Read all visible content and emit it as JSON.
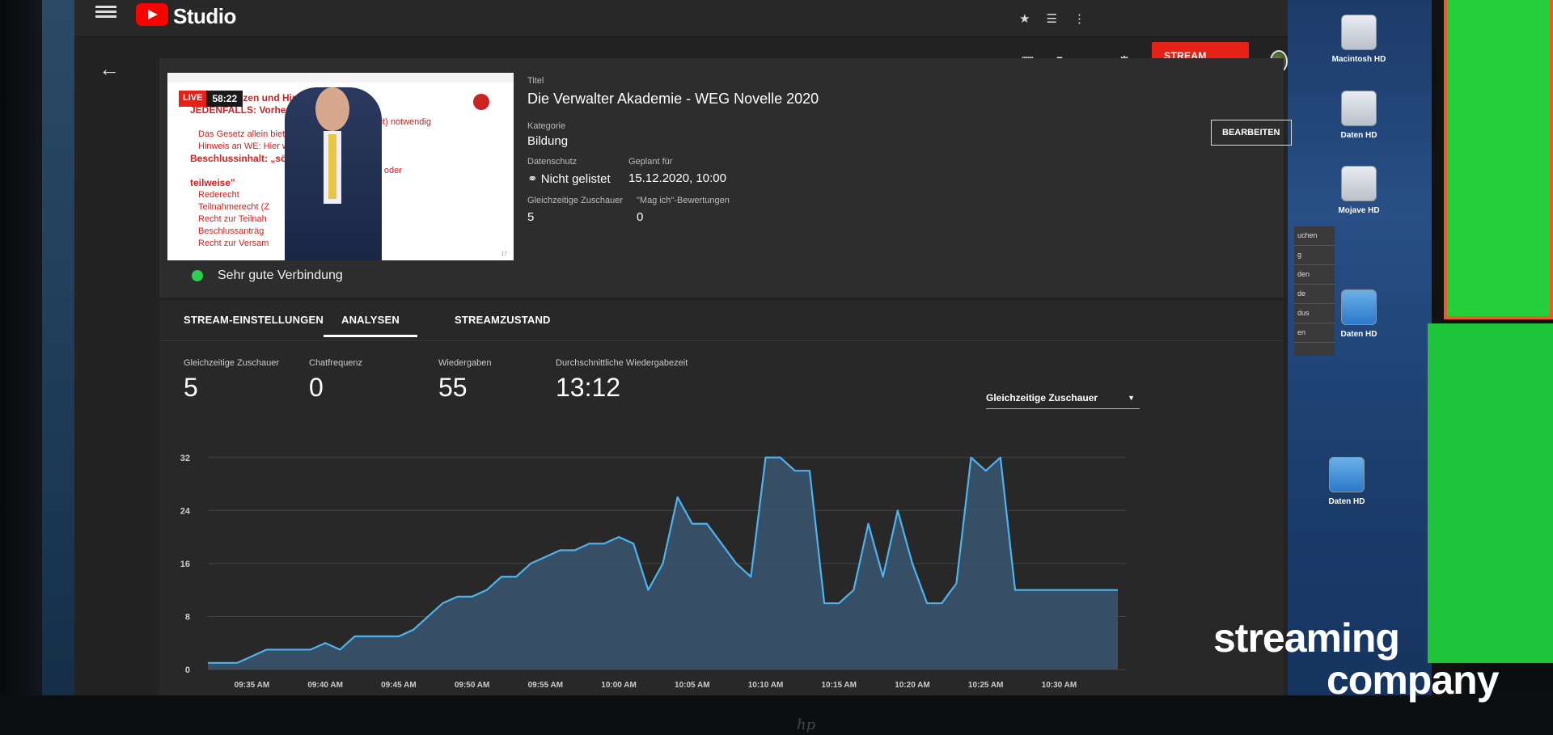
{
  "app": {
    "name": "Studio"
  },
  "actions": {
    "stream_end": "STREAM BEENDEN",
    "edit": "BEARBEITEN"
  },
  "preview": {
    "live_label": "LIVE",
    "elapsed": "58:22",
    "slide_lines": [
      "Konsequenzen und Hinw",
      "JEDENFALLS: Vorheriger B",
      "(einfache Mehrheit) notwendig",
      "Das Gesetz allein bietet kei",
      "Hinweis an WE: Hier wird",
      "Beschlussinhalt: „sö",
      "ihrer Rechte ganz oder",
      "teilweise\"",
      "Rederecht",
      "Teilnahmerecht (Z",
      "Recht zur Teilnah",
      "Beschlussanträg",
      "Recht zur Versam"
    ],
    "slide_page": "17"
  },
  "connection": {
    "status": "Sehr gute Verbindung"
  },
  "meta": {
    "title_label": "Titel",
    "title": "Die Verwalter Akademie - WEG Novelle 2020",
    "category_label": "Kategorie",
    "category": "Bildung",
    "privacy_label": "Datenschutz",
    "privacy": "Nicht gelistet",
    "scheduled_label": "Geplant für",
    "scheduled": "15.12.2020, 10:00",
    "concurrent_label": "Gleichzeitige Zuschauer",
    "concurrent": "5",
    "likes_label": "\"Mag ich\"-Bewertungen",
    "likes": "0"
  },
  "tabs": [
    {
      "label": "STREAM-EINSTELLUNGEN"
    },
    {
      "label": "ANALYSEN"
    },
    {
      "label": "STREAMZUSTAND"
    }
  ],
  "stats": [
    {
      "label": "Gleichzeitige Zuschauer",
      "value": "5"
    },
    {
      "label": "Chatfrequenz",
      "value": "0"
    },
    {
      "label": "Wiedergaben",
      "value": "55"
    },
    {
      "label": "Durchschnittliche Wiedergabezeit",
      "value": "13:12"
    }
  ],
  "metric_select": {
    "value": "Gleichzeitige Zuschauer"
  },
  "desktop_icons": [
    {
      "label": "Macintosh HD"
    },
    {
      "label": "Daten HD"
    },
    {
      "label": "Mojave HD"
    },
    {
      "label": "Daten HD"
    },
    {
      "label": "Daten HD"
    }
  ],
  "side_panel": [
    "uchen",
    "g",
    "den",
    "de",
    "dus",
    "en"
  ],
  "brand": {
    "line1": "streaming",
    "line2": "company"
  },
  "colors": {
    "accent_red": "#e62117",
    "series": "#4fb3f0",
    "area": "#3a5670",
    "ok_green": "#2bd14d"
  },
  "chart_data": {
    "type": "area",
    "ylim": [
      0,
      36
    ],
    "yticks": [
      0,
      8,
      16,
      24,
      32
    ],
    "xtick_labels": [
      "09:35 AM",
      "09:40 AM",
      "09:45 AM",
      "09:50 AM",
      "09:55 AM",
      "10:00 AM",
      "10:05 AM",
      "10:10 AM",
      "10:15 AM",
      "10:20 AM",
      "10:25 AM",
      "10:30 AM"
    ],
    "x_minutes_from": "09:32 AM",
    "series": [
      {
        "x": [
          0,
          2,
          3,
          4,
          5,
          6,
          7,
          8,
          9,
          10,
          11,
          12,
          13,
          14,
          15,
          16,
          17,
          18,
          19,
          20,
          21,
          22,
          23,
          24,
          25,
          26,
          27,
          28,
          29,
          30,
          31,
          32,
          33,
          34,
          35,
          36,
          37,
          38,
          39,
          40,
          41,
          42,
          43,
          44,
          45,
          46,
          47,
          48,
          49,
          50,
          51,
          52,
          53,
          54,
          55,
          56,
          57,
          58,
          59,
          60,
          61,
          62
        ],
        "y": [
          1,
          1,
          2,
          3,
          3,
          3,
          3,
          4,
          3,
          5,
          5,
          5,
          5,
          6,
          8,
          10,
          11,
          11,
          12,
          14,
          14,
          16,
          17,
          18,
          18,
          19,
          19,
          20,
          19,
          12,
          16,
          26,
          22,
          22,
          19,
          16,
          14,
          32,
          32,
          30,
          30,
          10,
          10,
          12,
          22,
          14,
          24,
          16,
          10,
          10,
          13,
          32,
          30,
          32,
          12,
          12,
          12,
          12,
          12,
          12,
          12,
          12
        ]
      }
    ]
  }
}
